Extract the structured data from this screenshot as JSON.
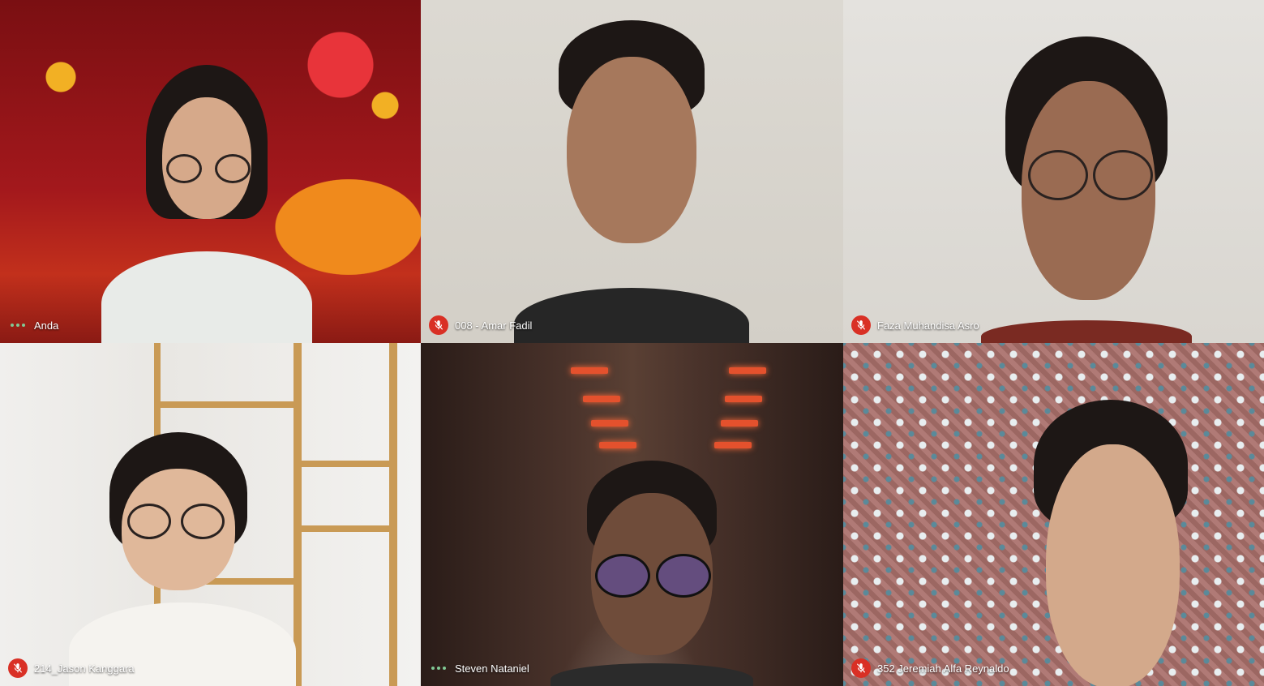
{
  "participants": [
    {
      "name": "Anda",
      "mic": "speaking"
    },
    {
      "name": "008 - Amar Fadil",
      "mic": "muted"
    },
    {
      "name": "Faza Muhandisa Asro",
      "mic": "muted"
    },
    {
      "name": "214_Jason Kanggara",
      "mic": "muted"
    },
    {
      "name": "Steven Nataniel",
      "mic": "speaking"
    },
    {
      "name": "352 Jeremiah Alfa Reynaldo",
      "mic": "muted"
    }
  ],
  "icons": {
    "muted": "mic-off-icon",
    "speaking": "audio-dots-icon"
  },
  "colors": {
    "muted_badge": "#d93025",
    "speaking_dots": "#81c995",
    "background": "#202124"
  }
}
